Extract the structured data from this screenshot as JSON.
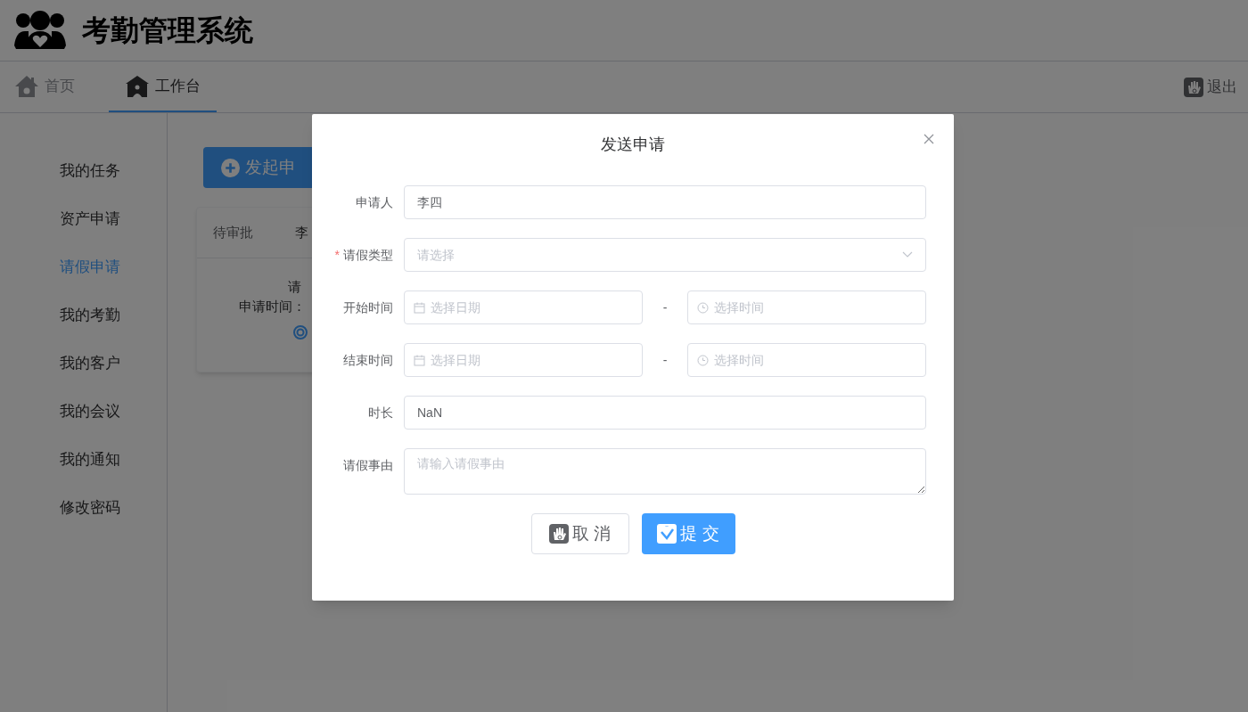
{
  "app": {
    "title": "考勤管理系统"
  },
  "nav_tabs": [
    {
      "label": "首页",
      "selected": false
    },
    {
      "label": "工作台",
      "selected": true
    }
  ],
  "logout": {
    "label": "退出"
  },
  "sidebar": {
    "items": [
      {
        "label": "我的任务",
        "selected": false
      },
      {
        "label": "资产申请",
        "selected": false
      },
      {
        "label": "请假申请",
        "selected": true
      },
      {
        "label": "我的考勤",
        "selected": false
      },
      {
        "label": "我的客户",
        "selected": false
      },
      {
        "label": "我的会议",
        "selected": false
      },
      {
        "label": "我的通知",
        "selected": false
      },
      {
        "label": "修改密码",
        "selected": false
      }
    ]
  },
  "launch_button": {
    "label": "发起申"
  },
  "request_card": {
    "header_cells": [
      "待审批",
      "李"
    ],
    "lines": [
      "请",
      "申请时间："
    ]
  },
  "dialog": {
    "title": "发送申请",
    "fields": [
      {
        "kind": "text",
        "label": "申请人",
        "value": "李四"
      },
      {
        "kind": "select",
        "required_mark": "*",
        "label": "请假类型",
        "placeholder": "请选择"
      },
      {
        "kind": "datetime",
        "label": "开始时间",
        "date_placeholder": "选择日期",
        "separator": "-",
        "time_placeholder": "选择时间"
      },
      {
        "kind": "datetime",
        "label": "结束时间",
        "date_placeholder": "选择日期",
        "separator": "-",
        "time_placeholder": "选择时间"
      },
      {
        "kind": "text",
        "label": "时长",
        "value": "NaN"
      },
      {
        "kind": "textarea",
        "label": "请假事由",
        "placeholder": "请输入请假事由"
      }
    ],
    "buttons": [
      {
        "kind": "cancel",
        "label": "取 消"
      },
      {
        "kind": "submit",
        "label": "提 交"
      }
    ]
  }
}
